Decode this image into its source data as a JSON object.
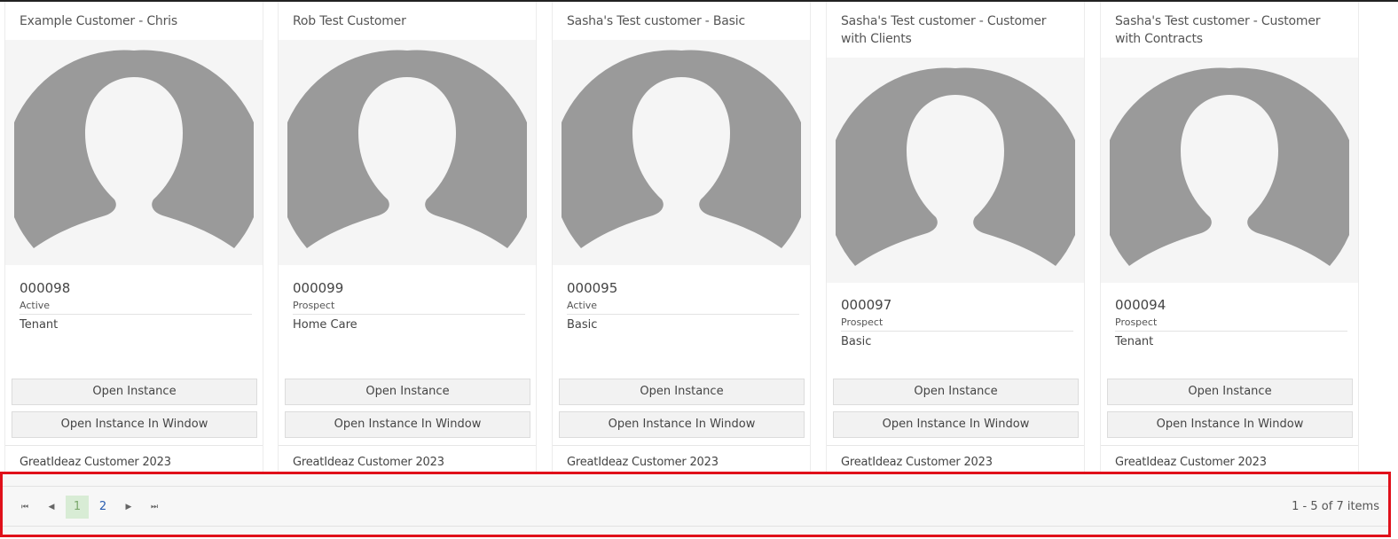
{
  "cards": [
    {
      "title": "Example Customer - Chris",
      "code": "000098",
      "status": "Active",
      "type": "Tenant",
      "open_label": "Open Instance",
      "open_window_label": "Open Instance In Window",
      "footer": "GreatIdeaz Customer 2023"
    },
    {
      "title": "Rob Test Customer",
      "code": "000099",
      "status": "Prospect",
      "type": "Home Care",
      "open_label": "Open Instance",
      "open_window_label": "Open Instance In Window",
      "footer": "GreatIdeaz Customer 2023"
    },
    {
      "title": "Sasha's Test customer - Basic",
      "code": "000095",
      "status": "Active",
      "type": "Basic",
      "open_label": "Open Instance",
      "open_window_label": "Open Instance In Window",
      "footer": "GreatIdeaz Customer 2023"
    },
    {
      "title": "Sasha's Test customer - Customer with Clients",
      "code": "000097",
      "status": "Prospect",
      "type": "Basic",
      "open_label": "Open Instance",
      "open_window_label": "Open Instance In Window",
      "footer": "GreatIdeaz Customer 2023"
    },
    {
      "title": "Sasha's Test customer - Customer with Contracts",
      "code": "000094",
      "status": "Prospect",
      "type": "Tenant",
      "open_label": "Open Instance",
      "open_window_label": "Open Instance In Window",
      "footer": "GreatIdeaz Customer 2023"
    }
  ],
  "pager": {
    "first_icon": "first-page-icon",
    "prev_icon": "previous-page-icon",
    "next_icon": "next-page-icon",
    "last_icon": "last-page-icon",
    "pages": [
      "1",
      "2"
    ],
    "current_page": "1",
    "info": "1 - 5 of 7 items"
  },
  "colors": {
    "highlight_border": "#e0101a",
    "active_page_bg": "#d8ecd5",
    "avatar_gray": "#9a9a9a"
  }
}
